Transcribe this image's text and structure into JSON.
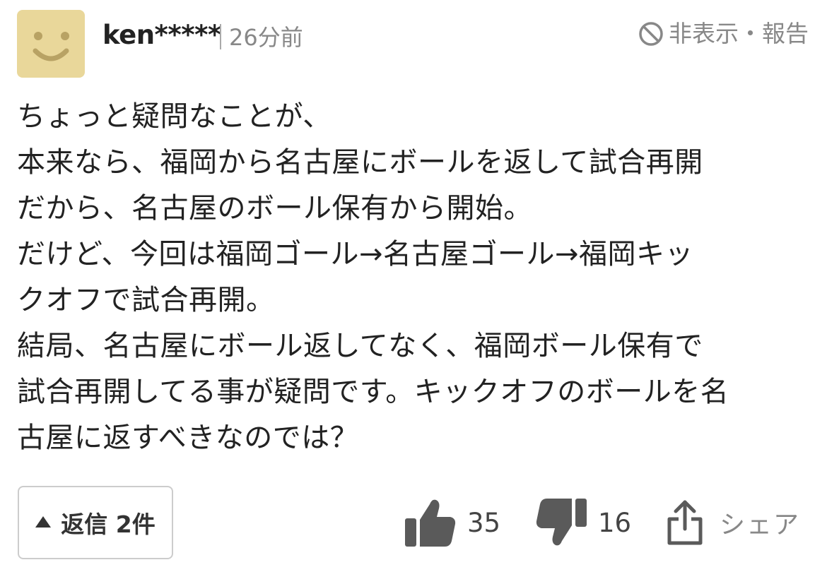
{
  "comment": {
    "user": {
      "name": "ken*****",
      "avatar_color": "#e9d79a",
      "avatar_icon": "smiley-face-icon"
    },
    "timestamp": "26分前",
    "report_label": "非表示・報告",
    "body": "ちょっと疑問なことが、\n本来なら、福岡から名古屋にボールを返して試合再開\nだから、名古屋のボール保有から開始。\nだけど、今回は福岡ゴール→名古屋ゴール→福岡キッ\nクオフで試合再開。\n結局、名古屋にボール返してなく、福岡ボール保有で\n試合再開してる事が疑問です。キックオフのボールを名\n古屋に返すべきなのでは？"
  },
  "footer": {
    "reply_label": "返信 2件",
    "likes": "35",
    "dislikes": "16",
    "share_label": "シェア"
  },
  "colors": {
    "text": "#222222",
    "muted": "#888888",
    "icon": "#5a5a5a",
    "border": "#cccccc"
  }
}
